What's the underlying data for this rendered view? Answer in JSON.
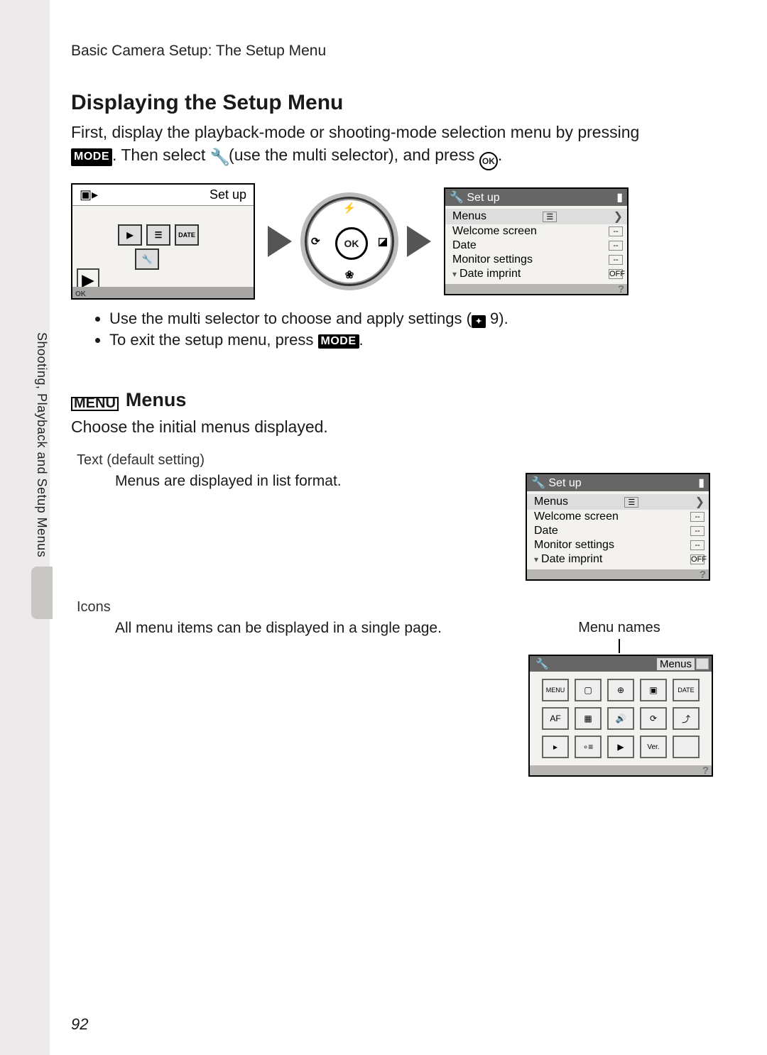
{
  "breadcrumb": "Basic Camera Setup: The Setup Menu",
  "h1": "Displaying the Setup Menu",
  "intro_line1": "First, display the playback-mode or shooting-mode selection menu by pressing",
  "intro_badge1": "MODE",
  "intro_line2a": ". Then select ",
  "intro_line2b": " (use the multi selector), and press ",
  "ok_glyph": "OK",
  "mode_lcd_title": "Set up",
  "dpad_center": "OK",
  "dpad_n": "⚡",
  "dpad_s": "❀",
  "dpad_e": "◪",
  "dpad_w": "⟳",
  "setup_lcd": {
    "title": "Set up",
    "rows": [
      {
        "label": "Menus",
        "ind": "☰",
        "sel": true
      },
      {
        "label": "Welcome screen",
        "ind": "--"
      },
      {
        "label": "Date",
        "ind": "--"
      },
      {
        "label": "Monitor settings",
        "ind": "--"
      },
      {
        "label": "Date imprint",
        "ind": "OFF",
        "caret": true
      }
    ]
  },
  "bullets": {
    "b1a": "Use the multi selector to choose and apply settings (",
    "b1_icon": "✦",
    "b1b": " 9).",
    "b2a": "To exit the setup menu, press ",
    "b2_badge": "MODE",
    "b2b": "."
  },
  "menus_heading_glyph": "MENU",
  "menus_heading": "Menus",
  "menus_intro": "Choose the initial menus displayed.",
  "opt_text_label": "Text (default setting)",
  "opt_text_desc": "Menus are displayed in list format.",
  "opt_icons_label": "Icons",
  "opt_icons_desc": "All menu items can be displayed in a single page.",
  "menu_names_caption": "Menu names",
  "icons_lcd": {
    "corner_label": "Menus",
    "grid": [
      "MENU",
      "▢",
      "⊕",
      "▣",
      "DATE",
      "AF",
      "▦",
      "🔊",
      "⟳",
      "⤴",
      "▸",
      "∘≡",
      "▶",
      "Ver.",
      ""
    ]
  },
  "sidetab": "Shooting, Playback and Setup Menus",
  "page_number": "92"
}
